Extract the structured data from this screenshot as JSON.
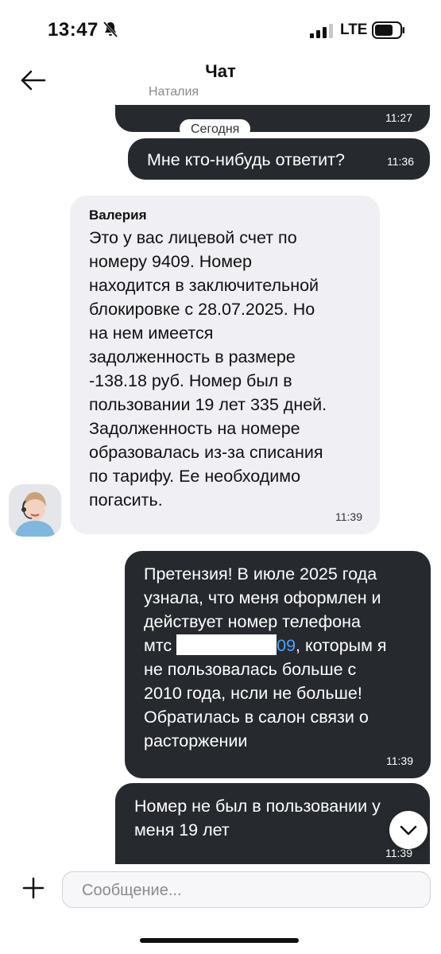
{
  "status_bar": {
    "time": "13:47",
    "network": "LTE"
  },
  "header": {
    "title": "Чат",
    "subtitle": "Наталия"
  },
  "messages": [
    {
      "sender": "",
      "text": "",
      "time": "11:27"
    },
    {
      "sender": "",
      "text": "Мне кто-нибудь ответит?",
      "time": "11:36"
    },
    {
      "sender": "Валерия",
      "lines": [
        "Это у вас лицевой счет по",
        "номеру 9409. Номер",
        "находится в заключительной",
        "блокировке с 28.07.2025. Но",
        "на нем имеется",
        "задолженность в размере",
        "-138.18 руб. Номер был в",
        "пользовании 19 лет 335 дней.",
        "Задолженность на номере",
        "образовалась из-за списания",
        "по тарифу. Ее необходимо",
        "погасить."
      ],
      "time": "11:39"
    },
    {
      "lines_before": [
        "Претензия! В июле 2025 года",
        "узнала, что меня оформлен и",
        "действует номер телефона"
      ],
      "mts": "мтс",
      "number_suffix": "09",
      "after_number": ", которым я",
      "lines_after": [
        "не пользовалась больше с",
        "2010 года, нсли не больше!",
        "Обратилась в салон связи о",
        "расторжении"
      ],
      "time": "11:39"
    },
    {
      "lines": [
        "Номер не был в пользовании у",
        "меня 19 лет"
      ],
      "time": "11:39"
    }
  ],
  "date_separator": "Сегодня",
  "composer": {
    "placeholder": "Сообщение..."
  },
  "colors": {
    "bubble_out": "#26292e",
    "bubble_in": "#efeff4",
    "link": "#4aa3ff"
  }
}
